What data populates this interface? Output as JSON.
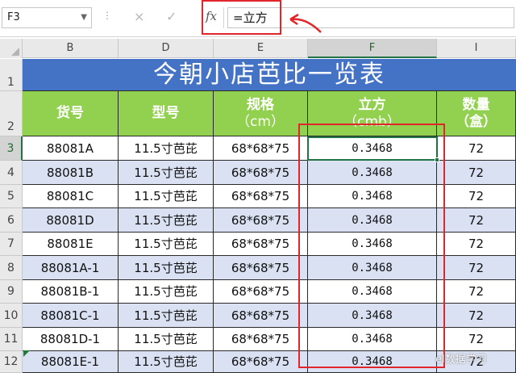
{
  "formula_bar": {
    "name_box": "F3",
    "cancel_icon": "×",
    "enter_icon": "✓",
    "fx_label": "fx",
    "formula": "=立方"
  },
  "columns": [
    "B",
    "D",
    "E",
    "F",
    "I"
  ],
  "rows": [
    "1",
    "2",
    "3",
    "4",
    "5",
    "6",
    "7",
    "8",
    "9",
    "10",
    "11",
    "12"
  ],
  "table": {
    "title": "今朝小店芭比一览表",
    "headers": [
      {
        "line1": "货号",
        "line2": ""
      },
      {
        "line1": "型号",
        "line2": ""
      },
      {
        "line1": "规格",
        "line2": "（cm）"
      },
      {
        "line1": "立方",
        "line2": "（cmb）"
      },
      {
        "line1": "数量",
        "line2": "（盒）"
      }
    ],
    "rows": [
      [
        "88081A",
        "11.5寸芭芘",
        "68*68*75",
        "0.3468",
        "72"
      ],
      [
        "88081B",
        "11.5寸芭芘",
        "68*68*75",
        "0.3468",
        "72"
      ],
      [
        "88081C",
        "11.5寸芭芘",
        "68*68*75",
        "0.3468",
        "72"
      ],
      [
        "88081D",
        "11.5寸芭芘",
        "68*68*75",
        "0.3468",
        "72"
      ],
      [
        "88081E",
        "11.5寸芭芘",
        "68*68*75",
        "0.3468",
        "72"
      ],
      [
        "88081A-1",
        "11.5寸芭芘",
        "68*68*75",
        "0.3468",
        "72"
      ],
      [
        "88081B-1",
        "11.5寸芭芘",
        "68*68*75",
        "0.3468",
        "72"
      ],
      [
        "88081C-1",
        "11.5寸芭芘",
        "68*68*75",
        "0.3468",
        "72"
      ],
      [
        "88081D-1",
        "11.5寸芭芘",
        "68*68*75",
        "0.3468",
        "72"
      ],
      [
        "88081E-1",
        "11.5寸芭芘",
        "68*68*75",
        "0.3468",
        "72"
      ]
    ]
  },
  "watermark": "el数据学习",
  "colors": {
    "title_bg": "#4472c4",
    "header_bg": "#92d050",
    "band": "#d9e1f2",
    "highlight": "#e0262a",
    "selection": "#217346"
  }
}
